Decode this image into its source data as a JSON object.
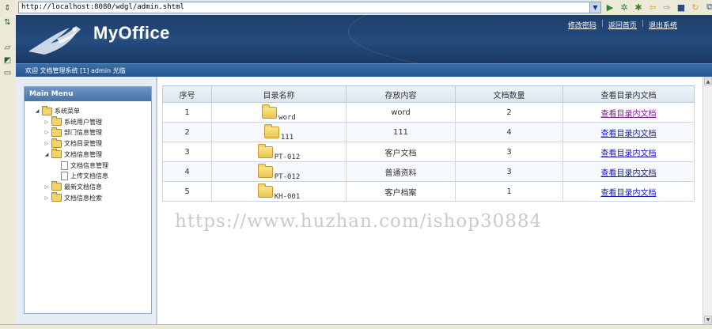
{
  "address_bar": {
    "url": "http://localhost:8080/wdgl/admin.shtml"
  },
  "header": {
    "logo": "MyOffice",
    "links": [
      "修改密码",
      "返回首页",
      "退出系统"
    ],
    "welcome": "欢迎 文档管理系统 [1] admin 光临"
  },
  "sidebar": {
    "title": "Main Menu",
    "tree": [
      {
        "label": "系统菜单",
        "depth": 0,
        "open": true,
        "type": "folder"
      },
      {
        "label": "系统用户管理",
        "depth": 1,
        "open": false,
        "type": "folder"
      },
      {
        "label": "部门信息管理",
        "depth": 1,
        "open": false,
        "type": "folder"
      },
      {
        "label": "文档目录管理",
        "depth": 1,
        "open": false,
        "type": "folder"
      },
      {
        "label": "文档信息管理",
        "depth": 1,
        "open": true,
        "type": "folder"
      },
      {
        "label": "文档信息管理",
        "depth": 2,
        "open": false,
        "type": "doc"
      },
      {
        "label": "上传文档信息",
        "depth": 2,
        "open": false,
        "type": "doc"
      },
      {
        "label": "最新文档信息",
        "depth": 1,
        "open": false,
        "type": "folder"
      },
      {
        "label": "文档信息检索",
        "depth": 1,
        "open": false,
        "type": "folder"
      }
    ]
  },
  "table": {
    "columns": [
      "序号",
      "目录名称",
      "存放内容",
      "文档数量",
      "查看目录内文档"
    ],
    "rows": [
      {
        "no": "1",
        "name": "word",
        "content": "word",
        "count": "2",
        "link": "查看目录内文档"
      },
      {
        "no": "2",
        "name": "111",
        "content": "111",
        "count": "4",
        "link": "查看目录内文档"
      },
      {
        "no": "3",
        "name": "PT-012",
        "content": "客户文档",
        "count": "3",
        "link": "查看目录内文档"
      },
      {
        "no": "4",
        "name": "PT-012",
        "content": "普通资料",
        "count": "3",
        "link": "查看目录内文档"
      },
      {
        "no": "5",
        "name": "KH-001",
        "content": "客户档案",
        "count": "1",
        "link": "查看目录内文档"
      }
    ]
  },
  "watermark": "https://www.huzhan.com/ishop30884"
}
